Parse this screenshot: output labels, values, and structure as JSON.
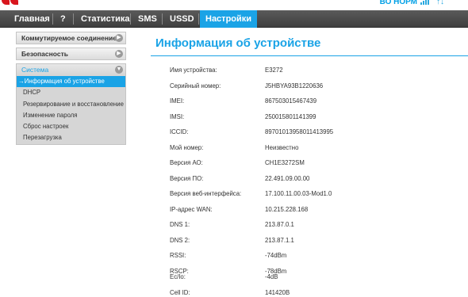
{
  "header": {
    "status_text": "ВО НОРМ",
    "arrows_icon": "up-down-arrows-icon"
  },
  "nav": {
    "tabs": [
      {
        "label": "Главная",
        "active": false
      },
      {
        "label": "?",
        "active": false
      },
      {
        "label": "Статистика",
        "active": false
      },
      {
        "label": "SMS",
        "active": false
      },
      {
        "label": "USSD",
        "active": false
      },
      {
        "label": "Настройки",
        "active": true
      }
    ]
  },
  "sidebar": {
    "sections": [
      {
        "label": "Коммутируемое соединение"
      },
      {
        "label": "Безопасность"
      }
    ],
    "system": {
      "label": "Система",
      "items": [
        {
          "label": "→Информация об устройстве",
          "active": true
        },
        {
          "label": "DHCP",
          "active": false
        },
        {
          "label": "Резервирование и восстановление",
          "active": false
        },
        {
          "label": "Изменение пароля",
          "active": false
        },
        {
          "label": "Сброс настроек",
          "active": false
        },
        {
          "label": "Перезагрузка",
          "active": false
        }
      ]
    }
  },
  "main": {
    "title": "Информация об устройстве",
    "rows": [
      {
        "label": "Имя устройства:",
        "value": "E3272"
      },
      {
        "label": "Серийный номер:",
        "value": "J5HBYA93B1220636"
      },
      {
        "label": "IMEI:",
        "value": "867503015467439"
      },
      {
        "label": "IMSI:",
        "value": "250015801141399"
      },
      {
        "label": "ICCID:",
        "value": "89701013958011413995"
      },
      {
        "label": "Мой номер:",
        "value": "Неизвестно"
      },
      {
        "label": "Версия АО:",
        "value": "CH1E3272SM"
      },
      {
        "label": "Версия ПО:",
        "value": "22.491.09.00.00"
      },
      {
        "label": "Версия веб-интерфейса:",
        "value": "17.100.11.00.03-Mod1.0"
      },
      {
        "label": "IP-адрес WAN:",
        "value": "10.215.228.168"
      },
      {
        "label": "DNS 1:",
        "value": "213.87.0.1"
      },
      {
        "label": "DNS 2:",
        "value": "213.87.1.1"
      },
      {
        "label": "RSSI:",
        "value": "-74dBm"
      },
      {
        "label": "RSCP:",
        "value": "-78dBm"
      },
      {
        "label": "Ec/Io:",
        "value": "-4dB"
      },
      {
        "label": "Cell ID:",
        "value": "141420B"
      }
    ]
  },
  "colors": {
    "accent": "#1aa3e6",
    "brand_red": "#d8151d",
    "navbar": "#4a4a4a"
  }
}
